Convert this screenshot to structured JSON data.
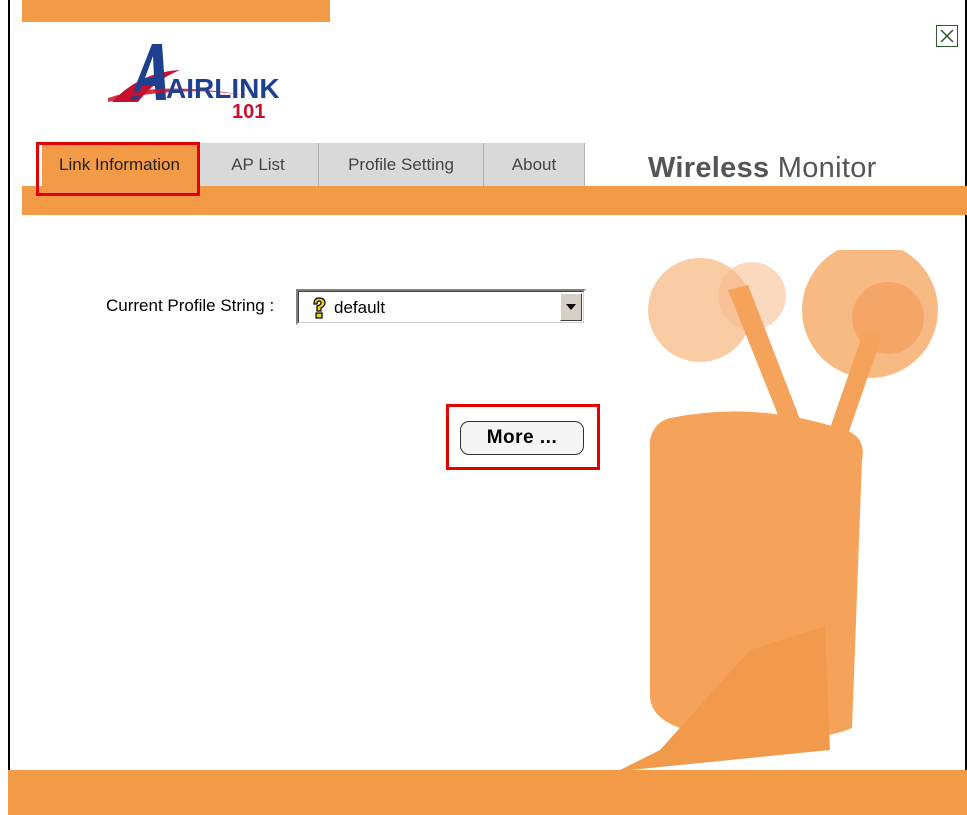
{
  "app": {
    "logo_text": "AIRLINK",
    "logo_number": "101",
    "brand_bold": "Wireless",
    "brand_light": "Monitor"
  },
  "tabs": [
    {
      "label": "Link Information",
      "active": true
    },
    {
      "label": "AP List",
      "active": false
    },
    {
      "label": "Profile Setting",
      "active": false
    },
    {
      "label": "About",
      "active": false
    }
  ],
  "profile": {
    "label": "Current Profile String :",
    "selected_value": "default"
  },
  "more_button": {
    "label": "More ..."
  },
  "icons": {
    "close": "close-icon",
    "profile": "question-key-icon",
    "dropdown": "chevron-down-icon"
  },
  "colors": {
    "accent": "#f39a46",
    "highlight": "#e50000",
    "tab_inactive": "#d9d9d9",
    "illustration": "#f5a35a"
  }
}
